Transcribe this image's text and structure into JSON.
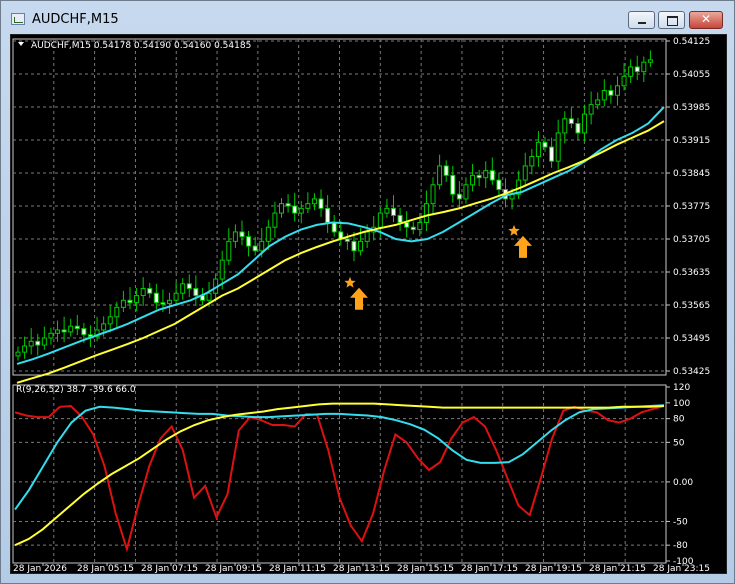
{
  "window": {
    "title": "AUDCHF,M15",
    "controls": {
      "minimize": "minimize",
      "maximize": "maximize",
      "close": "close"
    }
  },
  "chart_data": [
    {
      "type": "candlestick",
      "header": "AUDCHF,M15  0.54178 0.54190 0.54160 0.54185",
      "symbol": "AUDCHF,M15",
      "ohlc": {
        "open": 0.54178,
        "high": 0.5419,
        "low": 0.5416,
        "close": 0.54185
      },
      "ylim": [
        0.54125,
        0.54425
      ],
      "y_ticks": [
        "0.54125",
        "0.54055",
        "0.53985",
        "0.53915",
        "0.53845",
        "0.53775",
        "0.53705",
        "0.53635",
        "0.53565",
        "0.53495",
        "0.53425"
      ],
      "x_ticks": [
        "28 Jan 2026",
        "28 Jan 05:15",
        "28 Jan 07:15",
        "28 Jan 09:15",
        "28 Jan 11:15",
        "28 Jan 13:15",
        "28 Jan 15:15",
        "28 Jan 17:15",
        "28 Jan 19:15",
        "28 Jan 21:15",
        "28 Jan 23:15"
      ],
      "grid": true,
      "colors": {
        "bull": "#00cc00",
        "bear": "#ffffff",
        "ma_fast": "#33ddee",
        "ma_slow": "#ffff33",
        "signal": "#ffa31a"
      },
      "closes": [
        0.53465,
        0.53478,
        0.53488,
        0.5348,
        0.53495,
        0.53505,
        0.53512,
        0.53508,
        0.5352,
        0.53515,
        0.53502,
        0.53498,
        0.53512,
        0.53525,
        0.5354,
        0.5356,
        0.53575,
        0.5357,
        0.53585,
        0.536,
        0.5359,
        0.5357,
        0.53568,
        0.53575,
        0.5359,
        0.5361,
        0.536,
        0.53585,
        0.53575,
        0.5359,
        0.5362,
        0.5366,
        0.537,
        0.5372,
        0.5371,
        0.5369,
        0.5368,
        0.537,
        0.5373,
        0.5376,
        0.5378,
        0.53775,
        0.5376,
        0.5377,
        0.5378,
        0.5379,
        0.5377,
        0.5374,
        0.5372,
        0.53705,
        0.537,
        0.5368,
        0.537,
        0.5372,
        0.5373,
        0.5376,
        0.5377,
        0.53755,
        0.5374,
        0.5373,
        0.53725,
        0.5374,
        0.5378,
        0.5382,
        0.5386,
        0.5384,
        0.538,
        0.5379,
        0.5382,
        0.5384,
        0.53835,
        0.5385,
        0.5383,
        0.5381,
        0.5379,
        0.538,
        0.5383,
        0.5386,
        0.5388,
        0.5391,
        0.539,
        0.5387,
        0.5393,
        0.5396,
        0.5395,
        0.5393,
        0.5397,
        0.5399,
        0.54,
        0.5402,
        0.5401,
        0.5403,
        0.5405,
        0.5407,
        0.5406,
        0.5408,
        0.54085
      ],
      "ma_fast": [
        0.5344,
        0.5345,
        0.53462,
        0.53475,
        0.53488,
        0.535,
        0.53512,
        0.53525,
        0.5354,
        0.53555,
        0.53565,
        0.53575,
        0.5359,
        0.5361,
        0.5363,
        0.5366,
        0.5369,
        0.5371,
        0.53725,
        0.53735,
        0.5374,
        0.53738,
        0.5373,
        0.5372,
        0.53705,
        0.537,
        0.53705,
        0.5372,
        0.5374,
        0.5376,
        0.5378,
        0.53798,
        0.53805,
        0.5382,
        0.53835,
        0.5385,
        0.5387,
        0.53895,
        0.53915,
        0.5393,
        0.5395,
        0.53985
      ],
      "ma_slow": [
        0.534,
        0.5341,
        0.5342,
        0.53432,
        0.53445,
        0.53458,
        0.5347,
        0.53482,
        0.53495,
        0.5351,
        0.53525,
        0.53545,
        0.53565,
        0.53585,
        0.536,
        0.5362,
        0.5364,
        0.5366,
        0.53675,
        0.53688,
        0.537,
        0.5371,
        0.5372,
        0.53728,
        0.53735,
        0.53745,
        0.53755,
        0.53762,
        0.5377,
        0.5378,
        0.5379,
        0.53802,
        0.53815,
        0.5383,
        0.53845,
        0.53858,
        0.53872,
        0.53888,
        0.53905,
        0.5392,
        0.53935,
        0.53955
      ],
      "signals": [
        {
          "label": "buy-signal-1",
          "price": 0.5361
        },
        {
          "label": "buy-signal-2",
          "price": 0.5372
        }
      ]
    },
    {
      "type": "line",
      "header": "R(9,26,52) 38.7 -39.6 66.0",
      "params": "R(9,26,52)",
      "values_text": "38.7 -39.6 66.0",
      "ylim": [
        -100,
        120
      ],
      "y_ticks": [
        "120",
        "100",
        "80",
        "50",
        "0.00",
        "-50",
        "-80",
        "-100"
      ],
      "series": [
        {
          "color": "#dd1111",
          "values": [
            88,
            84,
            82,
            82,
            95,
            96,
            82,
            60,
            20,
            -40,
            -85,
            -30,
            20,
            55,
            70,
            40,
            -20,
            -5,
            -45,
            -15,
            65,
            82,
            78,
            72,
            72,
            70,
            86,
            85,
            40,
            -20,
            -55,
            -75,
            -40,
            15,
            60,
            50,
            30,
            15,
            25,
            55,
            75,
            82,
            70,
            40,
            5,
            -30,
            -42,
            5,
            55,
            90,
            95,
            90,
            88,
            78,
            75,
            80,
            88,
            92,
            96
          ]
        },
        {
          "color": "#33ddee",
          "values": [
            -35,
            -10,
            20,
            50,
            75,
            90,
            95,
            94,
            92,
            90,
            89,
            88,
            87,
            86,
            86,
            84,
            83,
            82,
            82,
            83,
            84,
            85,
            86,
            86,
            85,
            84,
            82,
            78,
            73,
            66,
            55,
            40,
            28,
            24,
            24,
            25,
            35,
            50,
            65,
            78,
            88,
            92,
            93,
            94,
            95,
            96,
            97
          ]
        },
        {
          "color": "#ffff33",
          "values": [
            -80,
            -72,
            -60,
            -45,
            -30,
            -15,
            -2,
            10,
            20,
            30,
            42,
            54,
            64,
            72,
            78,
            82,
            85,
            87,
            89,
            92,
            94,
            96,
            98,
            99,
            99,
            99,
            99,
            98,
            97,
            96,
            95,
            94,
            94,
            94,
            94,
            94,
            94,
            94,
            94,
            94,
            94,
            94,
            94,
            94,
            95,
            95,
            95,
            96
          ]
        }
      ]
    }
  ]
}
